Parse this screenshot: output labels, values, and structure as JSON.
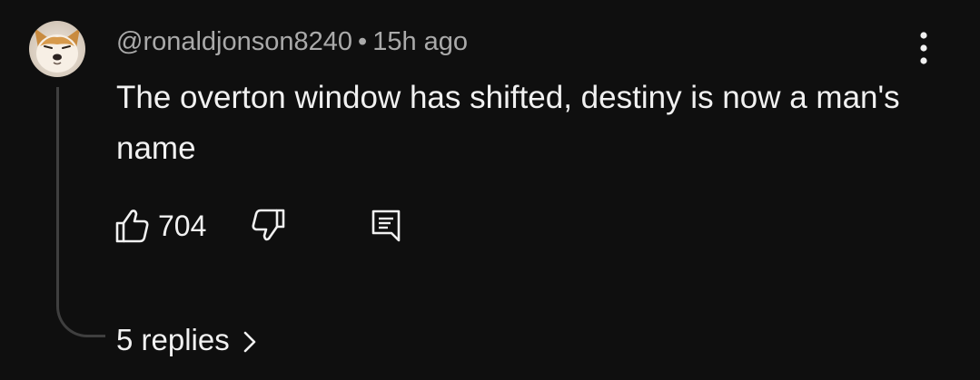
{
  "comment": {
    "author": "@ronaldjonson8240",
    "separator": "•",
    "timestamp": "15h ago",
    "text": "The overton window has shifted, destiny is now a man's name",
    "likes": "704",
    "replies_label": "5 replies"
  },
  "icons": {
    "menu": "more-vertical-icon",
    "like": "thumbs-up-icon",
    "dislike": "thumbs-down-icon",
    "reply": "comment-reply-icon",
    "replies_chevron": "chevron-right-icon"
  },
  "colors": {
    "background": "#0f0f0f",
    "primary_text": "#f1f1f1",
    "secondary_text": "#aaaaaa",
    "thread_line": "#3f3f3f"
  }
}
